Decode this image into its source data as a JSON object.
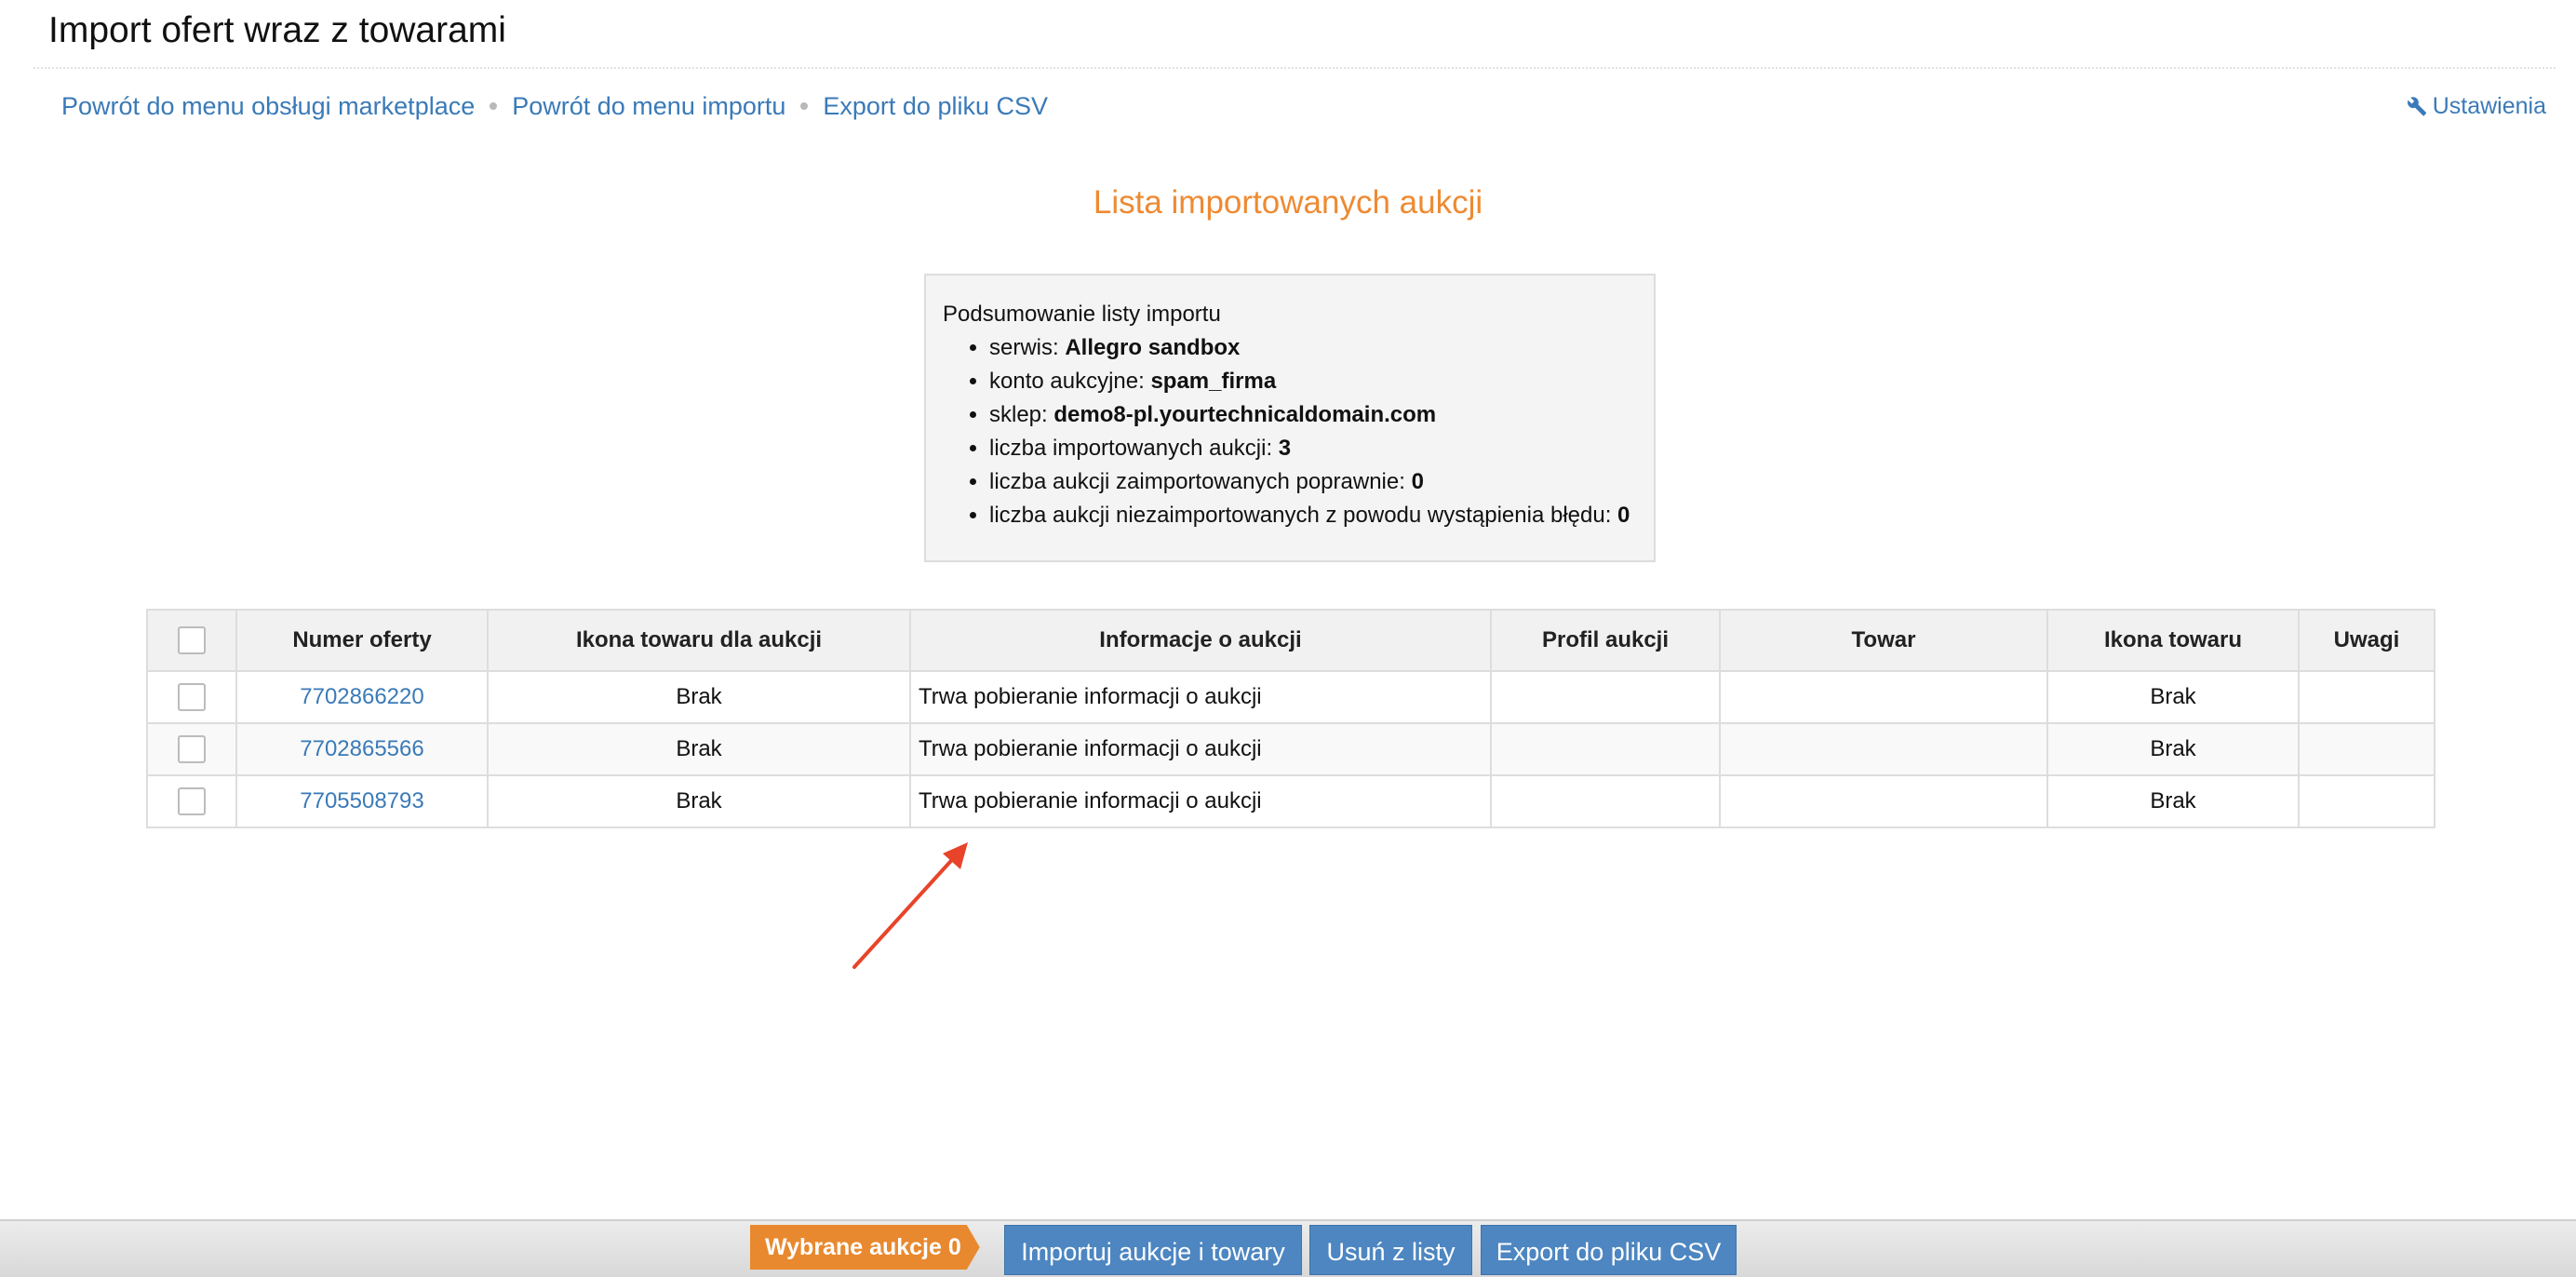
{
  "page": {
    "title": "Import ofert wraz z towarami"
  },
  "nav": {
    "items": [
      {
        "label": "Powrót do menu obsługi marketplace"
      },
      {
        "label": "Powrót do menu importu"
      },
      {
        "label": "Export do pliku CSV"
      }
    ],
    "settings_label": "Ustawienia",
    "settings_icon": "wrench-icon"
  },
  "list_title": "Lista importowanych aukcji",
  "summary": {
    "heading": "Podsumowanie listy importu",
    "items": [
      {
        "label": "serwis:",
        "value": "Allegro sandbox"
      },
      {
        "label": "konto aukcyjne:",
        "value": "spam_firma"
      },
      {
        "label": "sklep:",
        "value": "demo8-pl.yourtechnicaldomain.com"
      },
      {
        "label": "liczba importowanych aukcji:",
        "value": "3"
      },
      {
        "label": "liczba aukcji zaimportowanych poprawnie:",
        "value": "0"
      },
      {
        "label": "liczba aukcji niezaimportowanych z powodu wystąpienia błędu:",
        "value": "0"
      }
    ]
  },
  "table": {
    "headers": [
      "Numer oferty",
      "Ikona towaru dla aukcji",
      "Informacje o aukcji",
      "Profil aukcji",
      "Towar",
      "Ikona towaru",
      "Uwagi"
    ],
    "rows": [
      {
        "offer_number": "7702866220",
        "auction_icon": "Brak",
        "info": "Trwa pobieranie informacji o aukcji",
        "profile": "",
        "product": "",
        "product_icon": "Brak",
        "notes": ""
      },
      {
        "offer_number": "7702865566",
        "auction_icon": "Brak",
        "info": "Trwa pobieranie informacji o aukcji",
        "profile": "",
        "product": "",
        "product_icon": "Brak",
        "notes": ""
      },
      {
        "offer_number": "7705508793",
        "auction_icon": "Brak",
        "info": "Trwa pobieranie informacji o aukcji",
        "profile": "",
        "product": "",
        "product_icon": "Brak",
        "notes": ""
      }
    ]
  },
  "bottom_bar": {
    "selected_label": "Wybrane aukcje 0",
    "buttons": [
      {
        "label": "Importuj aukcje i towary"
      },
      {
        "label": "Usuń z listy"
      },
      {
        "label": "Export do pliku CSV"
      }
    ]
  },
  "colors": {
    "link": "#3a7ab8",
    "accent_orange": "#ee8a33",
    "button_blue": "#4d86c1",
    "annotation_arrow": "#e8442a"
  }
}
